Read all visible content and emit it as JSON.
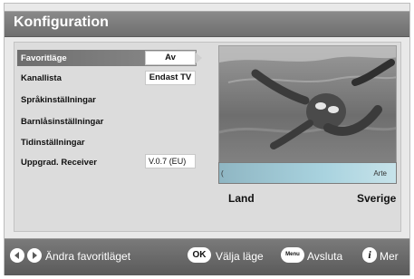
{
  "header": {
    "title": "Konfiguration"
  },
  "menu": {
    "items": [
      {
        "label": "Favoritläge",
        "value": "Av"
      },
      {
        "label": "Kanallista",
        "value": "Endast TV"
      },
      {
        "label": "Språkinställningar",
        "value": ""
      },
      {
        "label": "Barnlåsinställningar",
        "value": ""
      },
      {
        "label": "Tidinställningar",
        "value": ""
      },
      {
        "label": "Uppgrad. Receiver",
        "value": "V.0.7 (EU)"
      }
    ]
  },
  "country": {
    "label": "Land",
    "value": "Sverige",
    "slider_start": "(",
    "slider_text": "Arte"
  },
  "footer": {
    "change_label": "Ändra favoritläget",
    "ok_key": "OK",
    "select_label": "Välja läge",
    "menu_key": "Menu",
    "exit_label": "Avsluta",
    "info_key": "i",
    "more_label": "Mer"
  },
  "icons": [
    "left-arrow-icon",
    "right-arrow-icon",
    "ok-button-icon",
    "menu-button-icon",
    "info-icon"
  ],
  "colors": {
    "title_bar": "#7a7a7a",
    "selected_row": "#7a7a7a",
    "panel": "#dcdcdc",
    "slider": "#a9d3df"
  }
}
